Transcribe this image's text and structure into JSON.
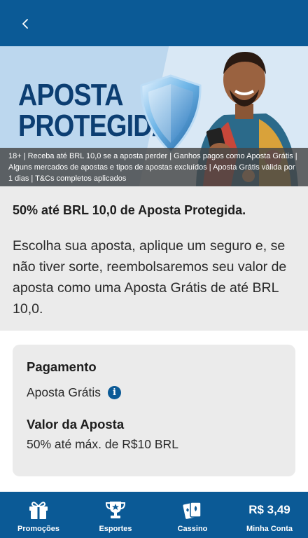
{
  "header": {
    "back_icon": "chevron-left-icon"
  },
  "banner": {
    "title_line1": "APOSTA",
    "title_line2": "PROTEGIDA",
    "disclaimer": "18+ | Receba até BRL 10,0 se a aposta perder | Ganhos pagos como Aposta Grátis | Alguns mercados de apostas e tipos de apostas excluídos | Aposta Grátis válida por 1 dias | T&Cs completos aplicados"
  },
  "offer": {
    "title": "50% até BRL 10,0 de Aposta Protegida.",
    "description": "Escolha sua aposta, aplique um seguro e, se não tiver sorte, reembolsaremos seu valor de aposta como uma Aposta Grátis de até BRL 10,0."
  },
  "details": {
    "payment_label": "Pagamento",
    "payment_value": "Aposta Grátis",
    "stake_label": "Valor da Aposta",
    "stake_value": "50% até máx. de R$10 BRL"
  },
  "nav": {
    "promotions": "Promoções",
    "sports": "Esportes",
    "casino": "Cassino",
    "balance": "R$ 3,49",
    "account": "Minha Conta"
  },
  "colors": {
    "brand_blue": "#0b5a96",
    "banner_title": "#0c3e72"
  }
}
